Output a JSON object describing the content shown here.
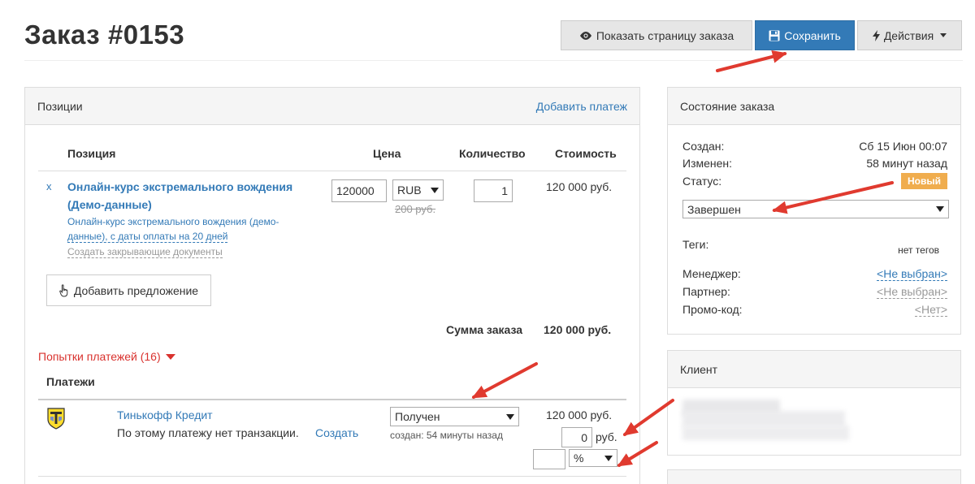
{
  "header": {
    "title": "Заказ #0153",
    "view_button": "Показать страницу заказа",
    "save_button": "Сохранить",
    "actions_button": "Действия"
  },
  "positions": {
    "title": "Позиции",
    "add_payment": "Добавить платеж",
    "columns": {
      "item": "Позиция",
      "price": "Цена",
      "qty": "Количество",
      "cost": "Стоимость"
    },
    "row": {
      "remove": "x",
      "name_line1": "Онлайн-курс экстремального вождения",
      "name_line2": "(Демо-данные)",
      "desc_line1": "Онлайн-курс экстремального вождения (демо-",
      "desc_line2": "данные), с даты оплаты на 20 дней",
      "docs": "Создать закрывающие документы",
      "price": "120000",
      "currency": "RUB",
      "old_price": "200 руб.",
      "qty": "1",
      "cost": "120 000 руб."
    },
    "add_offer": "Добавить предложение",
    "sum_label": "Сумма заказа",
    "sum_value": "120 000 руб.",
    "attempts": "Попытки платежей (16)",
    "payments_label": "Платежи",
    "payment": {
      "name": "Тинькофф Кредит",
      "note": "По этому платежу нет транзакции.",
      "create": "Создать",
      "status": "Получен",
      "created": "создан: 54 минуты назад",
      "amount": "120 000 руб.",
      "fee_value": "0",
      "fee_unit": "руб.",
      "percent_value": "",
      "percent_unit": "%"
    }
  },
  "status_panel": {
    "title": "Состояние заказа",
    "created_label": "Создан:",
    "created_value": "Сб 15 Июн 00:07",
    "changed_label": "Изменен:",
    "changed_value": "58 минут назад",
    "status_label": "Статус:",
    "status_badge": "Новый",
    "status_select": "Завершен",
    "tags_label": "Теги:",
    "tags_value": "нет тегов",
    "manager_label": "Менеджер:",
    "manager_value": "<Не выбран>",
    "partner_label": "Партнер:",
    "partner_value": "<Не выбран>",
    "promo_label": "Промо-код:",
    "promo_value": "<Нет>"
  },
  "client_panel": {
    "title": "Клиент"
  },
  "colors": {
    "primary": "#337ab7",
    "warning": "#f0ad4e",
    "danger": "#d9322e",
    "annotation": "#e03a2f"
  }
}
